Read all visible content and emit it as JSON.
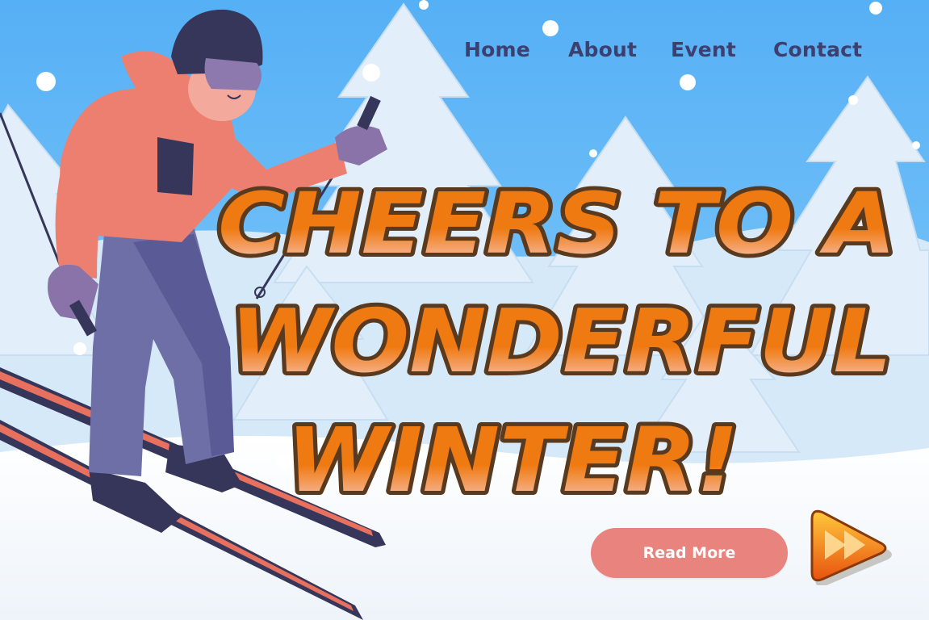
{
  "nav": {
    "items": [
      {
        "label": "Home"
      },
      {
        "label": "About"
      },
      {
        "label": "Event"
      },
      {
        "label": "Contact"
      }
    ]
  },
  "hero": {
    "headline_lines": [
      "CHEERS TO A",
      "WONDERFUL",
      "WINTER!"
    ],
    "cta_label": "Read More"
  },
  "colors": {
    "sky": "#5ab4f7",
    "snow": "#ffffff",
    "headline_orange": "#f07a12",
    "headline_outline": "#5a3a1e",
    "cta_button": "#e8837d",
    "nav_text": "#3d3f6e",
    "jacket": "#ec7f70",
    "pants": "#6f6fa8",
    "ski_blade": "#e8705f",
    "ski_base": "#353659"
  },
  "icons": {
    "next": "double-chevron-right-icon"
  }
}
